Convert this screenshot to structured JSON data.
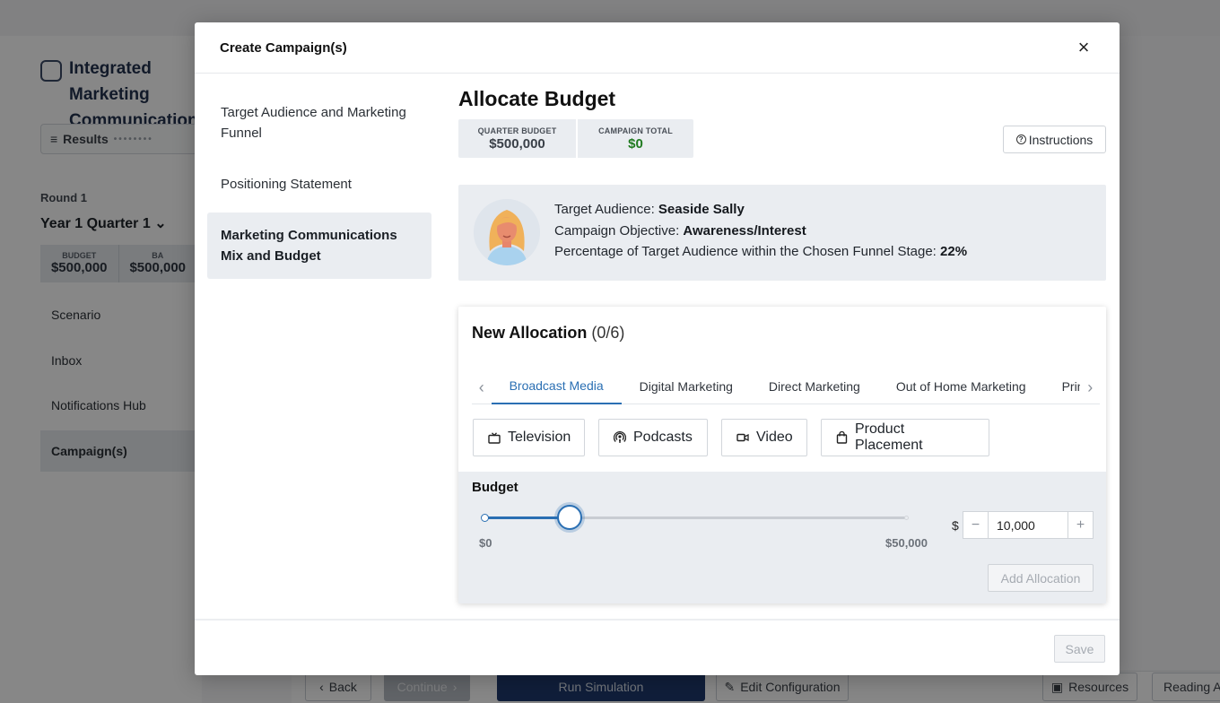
{
  "background": {
    "app_title": "Integrated Marketing\nCommunications",
    "results_label": "Results",
    "round_label": "Round 1",
    "year_quarter": "Year 1 Quarter 1",
    "budget_label": "BUDGET",
    "budget_value": "$500,000",
    "budget_value_2": "$500,000",
    "nav_items": [
      "Scenario",
      "Inbox",
      "Notifications Hub",
      "Campaign(s)"
    ],
    "active_nav": "Campaign(s)",
    "footer_buttons": {
      "back": "Back",
      "continue": "Continue",
      "run_simulation": "Run Simulation",
      "edit_configuration": "Edit Configuration",
      "resources": "Resources",
      "reading": "Reading A"
    }
  },
  "modal": {
    "title": "Create Campaign(s)",
    "close_symbol": "×",
    "steps": [
      "Target Audience and Marketing Funnel",
      "Positioning Statement",
      "Marketing Communications Mix and Budget"
    ],
    "active_step_index": 2,
    "heading": "Allocate Budget",
    "quarter_budget": {
      "label": "QUARTER BUDGET",
      "value": "$500,000"
    },
    "campaign_total": {
      "label": "CAMPAIGN TOTAL",
      "value": "$0"
    },
    "instructions_label": "Instructions",
    "audience": {
      "target_label": "Target Audience:",
      "target_value": "Seaside Sally",
      "objective_label": "Campaign Objective:",
      "objective_value": "Awareness/Interest",
      "percentage_label": "Percentage of Target Audience within the Chosen Funnel Stage:",
      "percentage_value": "22%"
    },
    "allocation": {
      "title": "New Allocation",
      "count": "(0/6)",
      "tabs": [
        "Broadcast Media",
        "Digital Marketing",
        "Direct Marketing",
        "Out of Home Marketing",
        "Print"
      ],
      "active_tab": "Broadcast Media",
      "channels": [
        {
          "label": "Television",
          "icon": "television-icon"
        },
        {
          "label": "Podcasts",
          "icon": "podcast-icon"
        },
        {
          "label": "Video",
          "icon": "video-camera-icon"
        },
        {
          "label": "Product Placement",
          "icon": "shopping-bag-icon"
        }
      ],
      "budget_label": "Budget",
      "slider_min_label": "$0",
      "slider_max_label": "$50,000",
      "slider_min": 0,
      "slider_max": 50000,
      "slider_value": 10000,
      "currency_symbol": "$",
      "amount_value": "10,000",
      "minus_symbol": "−",
      "plus_symbol": "+",
      "add_button": "Add Allocation"
    },
    "save_button": "Save"
  },
  "colors": {
    "accent": "#2a6fb3",
    "total_green": "#1f7a1f",
    "panel_gray": "#eaedf1"
  }
}
